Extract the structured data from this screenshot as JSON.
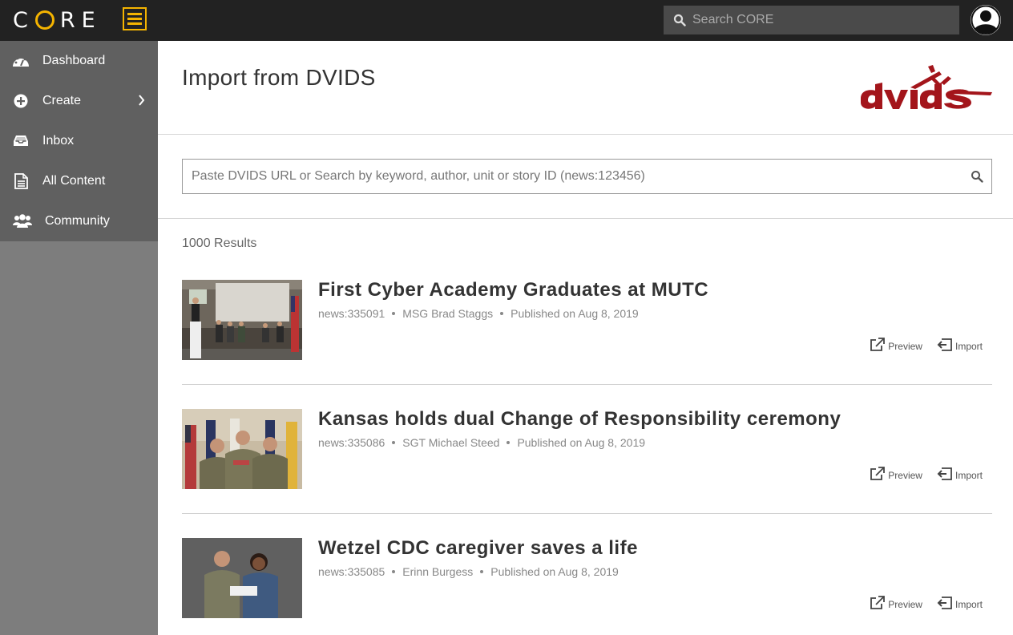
{
  "app": {
    "logo_text": "CORE"
  },
  "topbar": {
    "search_placeholder": "Search CORE"
  },
  "sidebar": {
    "items": [
      {
        "label": "Dashboard",
        "icon": "dashboard-icon"
      },
      {
        "label": "Create",
        "icon": "plus-circle-icon",
        "has_submenu": true
      },
      {
        "label": "Inbox",
        "icon": "inbox-icon"
      },
      {
        "label": "All Content",
        "icon": "document-icon"
      },
      {
        "label": "Community",
        "icon": "users-icon"
      }
    ]
  },
  "main": {
    "title": "Import from DVIDS",
    "brand_logo": "dvids",
    "search_placeholder": "Paste DVIDS URL or Search by keyword, author, unit or story ID (news:123456)",
    "results_count": "1000 Results",
    "preview_label": "Preview",
    "import_label": "Import",
    "results": [
      {
        "title": "First Cyber Academy Graduates at MUTC",
        "id": "news:335091",
        "author": "MSG Brad Staggs",
        "published": "Published on Aug 8, 2019"
      },
      {
        "title": "Kansas holds dual Change of Responsibility ceremony",
        "id": "news:335086",
        "author": "SGT Michael Steed",
        "published": "Published on Aug 8, 2019"
      },
      {
        "title": "Wetzel CDC caregiver saves a life",
        "id": "news:335085",
        "author": "Erinn Burgess",
        "published": "Published on Aug 8, 2019"
      }
    ]
  },
  "colors": {
    "accent": "#f5b400",
    "topbar": "#222222",
    "sidebar": "#7d7d7d",
    "sidenav": "#606060",
    "dvids_red": "#a3151b"
  }
}
